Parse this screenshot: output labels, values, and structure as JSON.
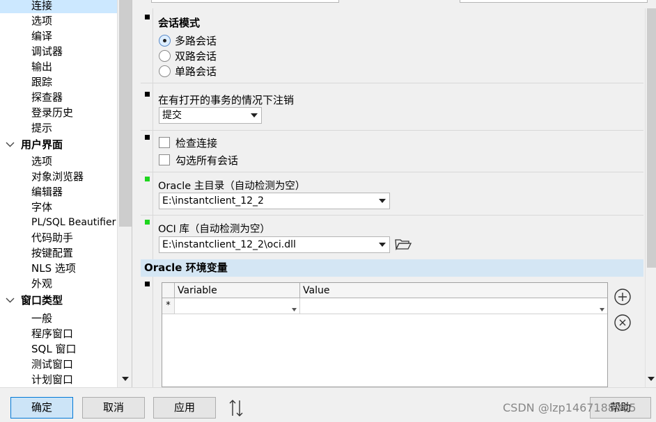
{
  "tree": {
    "items": [
      {
        "label": "连接",
        "selected": true
      },
      {
        "label": "选项"
      },
      {
        "label": "编译"
      },
      {
        "label": "调试器"
      },
      {
        "label": "输出"
      },
      {
        "label": "跟踪"
      },
      {
        "label": "探查器"
      },
      {
        "label": "登录历史"
      },
      {
        "label": "提示"
      }
    ],
    "group_ui": "用户界面",
    "ui_items": [
      "选项",
      "对象浏览器",
      "编辑器",
      "字体",
      "PL/SQL Beautifier",
      "代码助手",
      "按键配置",
      "NLS 选项",
      "外观"
    ],
    "group_window": "窗口类型",
    "window_items": [
      "一般",
      "程序窗口",
      "SQL 窗口",
      "测试窗口",
      "计划窗口"
    ]
  },
  "session": {
    "title": "会话模式",
    "options": [
      "多路会话",
      "双路会话",
      "单路会话"
    ],
    "selected": "多路会话"
  },
  "logoff": {
    "label": "在有打开的事务的情况下注销",
    "value": "提交"
  },
  "checks": {
    "check_connection": "检查连接",
    "check_all_sessions": "勾选所有会话"
  },
  "oracle_home": {
    "label": "Oracle 主目录（自动检测为空）",
    "value": "E:\\instantclient_12_2"
  },
  "oci": {
    "label": "OCI 库（自动检测为空）",
    "value": "E:\\instantclient_12_2\\oci.dll"
  },
  "env": {
    "header": "Oracle 环境变量",
    "col_variable": "Variable",
    "col_value": "Value",
    "new_row_marker": "*"
  },
  "buttons": {
    "ok": "确定",
    "cancel": "取消",
    "apply": "应用",
    "help": "帮助"
  },
  "watermark": "CSDN @lzp1467188365",
  "colors": {
    "selection": "#cce8ff",
    "env_header": "#d4e6f4",
    "green_marker": "#1ed51e",
    "primary_border": "#0078d7"
  }
}
